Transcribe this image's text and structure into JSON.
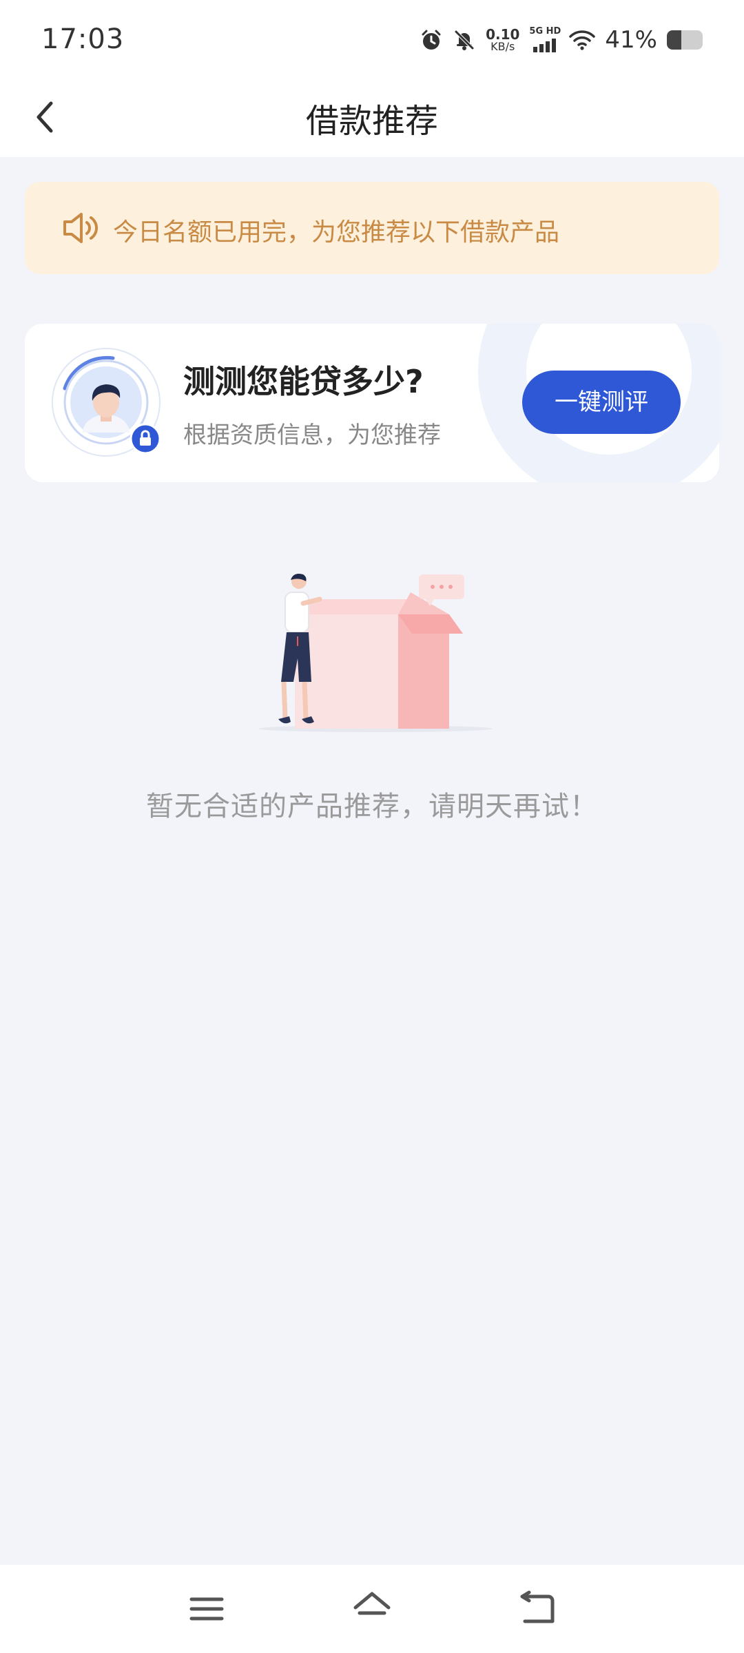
{
  "status_bar": {
    "time": "17:03",
    "net_speed_value": "0.10",
    "net_speed_unit": "KB/s",
    "signal_label": "5G HD",
    "battery_percent": "41%",
    "battery_level": 0.41,
    "icons": [
      "alarm-icon",
      "mute-bell-icon",
      "signal-icon",
      "wifi-icon",
      "battery-icon"
    ]
  },
  "header": {
    "title": "借款推荐",
    "back_icon": "chevron-left-icon"
  },
  "notice": {
    "icon": "speaker-icon",
    "text": "今日名额已用完，为您推荐以下借款产品"
  },
  "test_card": {
    "title": "测测您能贷多少?",
    "subtitle": "根据资质信息，为您推荐",
    "button_label": "一键测评",
    "avatar_icon": "avatar-with-lock-icon"
  },
  "empty_state": {
    "text": "暂无合适的产品推荐，请明天再试！",
    "illustration": "person-with-empty-box-illustration"
  },
  "nav_bar": {
    "icons": [
      "menu-icon",
      "home-icon",
      "back-icon"
    ]
  },
  "colors": {
    "accent": "#2f58d6",
    "notice_bg": "#fdf1de",
    "notice_text": "#c88a44",
    "page_bg": "#f3f4f9"
  }
}
